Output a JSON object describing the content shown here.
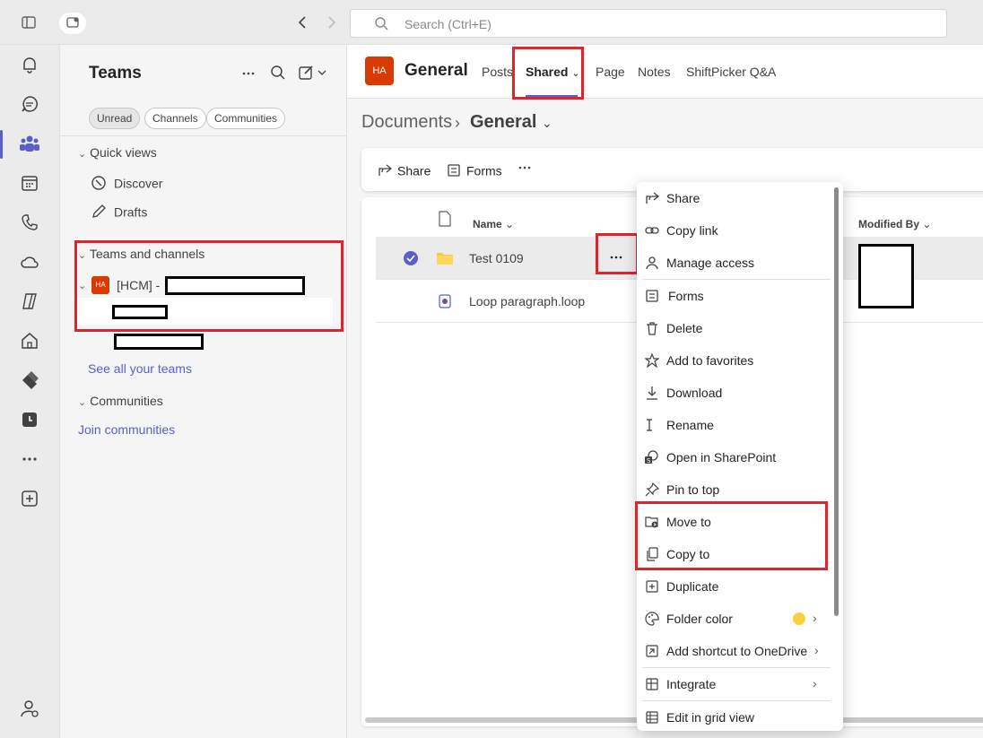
{
  "search": {
    "placeholder": "Search (Ctrl+E)"
  },
  "teams_pane": {
    "title": "Teams",
    "filters": [
      "Unread",
      "Channels",
      "Communities"
    ],
    "quick_views": {
      "header": "Quick views",
      "items": [
        "Discover",
        "Drafts"
      ]
    },
    "teams_and_channels": {
      "header": "Teams and channels",
      "team_prefix": "[HCM] -",
      "team_avatar": "HA"
    },
    "see_all": "See all your teams",
    "communities": {
      "header": "Communities",
      "join": "Join communities"
    }
  },
  "channel": {
    "avatar": "HA",
    "name": "General",
    "tabs": [
      "Posts",
      "Shared",
      "Page",
      "Notes",
      "ShiftPicker Q&A"
    ],
    "active_tab": "Shared"
  },
  "breadcrumb": {
    "root": "Documents",
    "current": "General"
  },
  "command_bar": {
    "share": "Share",
    "forms": "Forms"
  },
  "list": {
    "columns": {
      "name": "Name",
      "modified_by": "Modified By"
    },
    "rows": [
      {
        "name": "Test 0109",
        "type": "folder",
        "selected": true
      },
      {
        "name": "Loop paragraph.loop",
        "type": "loop"
      }
    ]
  },
  "context_menu": {
    "items": [
      "Share",
      "Copy link",
      "Manage access",
      "Forms",
      "Delete",
      "Add to favorites",
      "Download",
      "Rename",
      "Open in SharePoint",
      "Pin to top",
      "Move to",
      "Copy to",
      "Duplicate",
      "Folder color",
      "Add shortcut to OneDrive",
      "Integrate",
      "Edit in grid view"
    ],
    "folder_color_swatch": "#f9d13e"
  },
  "colors": {
    "accent": "#5b5fc7",
    "highlight": "#e0242b",
    "team_avatar": "#d83b01"
  }
}
